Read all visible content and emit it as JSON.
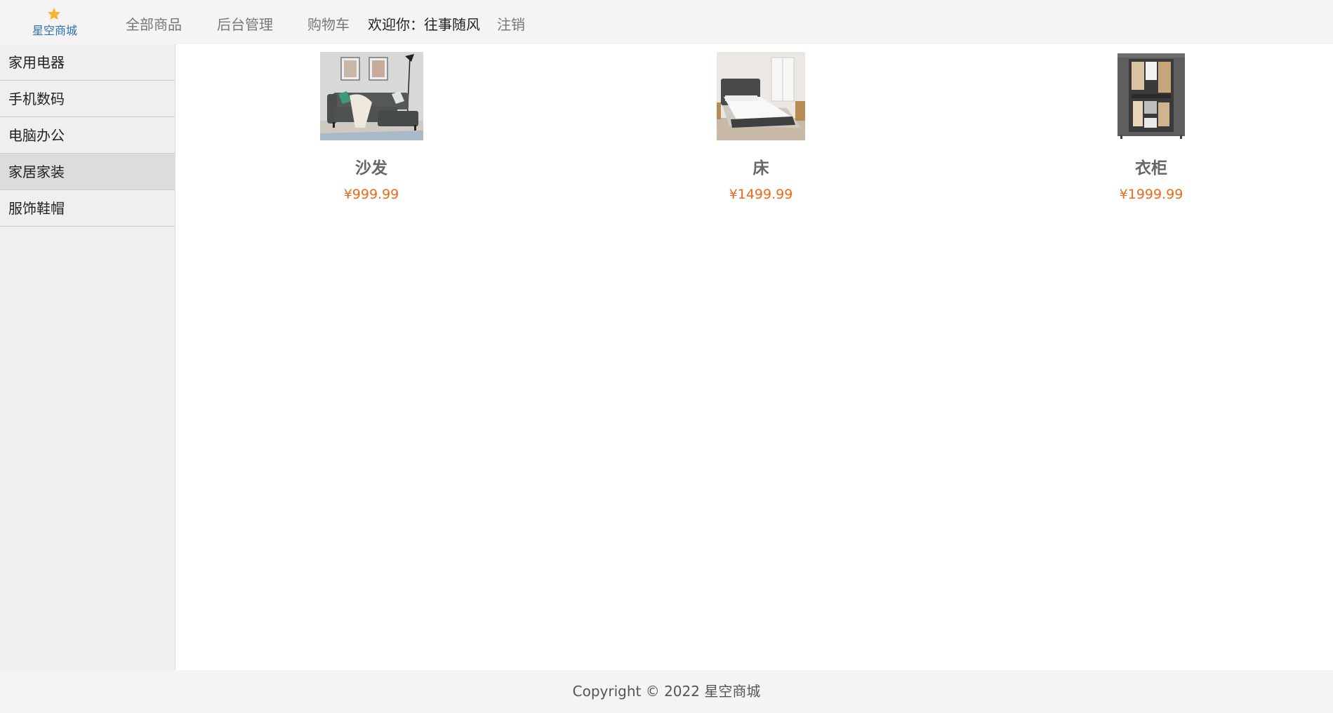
{
  "header": {
    "logo_text": "星空商城",
    "nav": {
      "all_products": "全部商品",
      "admin": "后台管理",
      "cart": "购物车",
      "welcome": "欢迎你：往事随风",
      "logout": "注销"
    }
  },
  "sidebar": {
    "items": [
      {
        "label": "家用电器"
      },
      {
        "label": "手机数码"
      },
      {
        "label": "电脑办公"
      },
      {
        "label": "家居家装"
      },
      {
        "label": "服饰鞋帽"
      }
    ],
    "active_index": 3
  },
  "products": [
    {
      "name": "沙发",
      "price": "¥999.99",
      "image_icon": "sofa-image"
    },
    {
      "name": "床",
      "price": "¥1499.99",
      "image_icon": "bed-image"
    },
    {
      "name": "衣柜",
      "price": "¥1999.99",
      "image_icon": "wardrobe-image"
    }
  ],
  "footer": {
    "copyright": "Copyright © 2022 星空商城"
  },
  "colors": {
    "brand_blue": "#2f6db5",
    "star_gold": "#f3b52a",
    "price_orange": "#ec6a1a",
    "header_bg": "#f4f4f4",
    "sidebar_bg": "#efefef",
    "sidebar_active_bg": "#dcdcdc"
  }
}
